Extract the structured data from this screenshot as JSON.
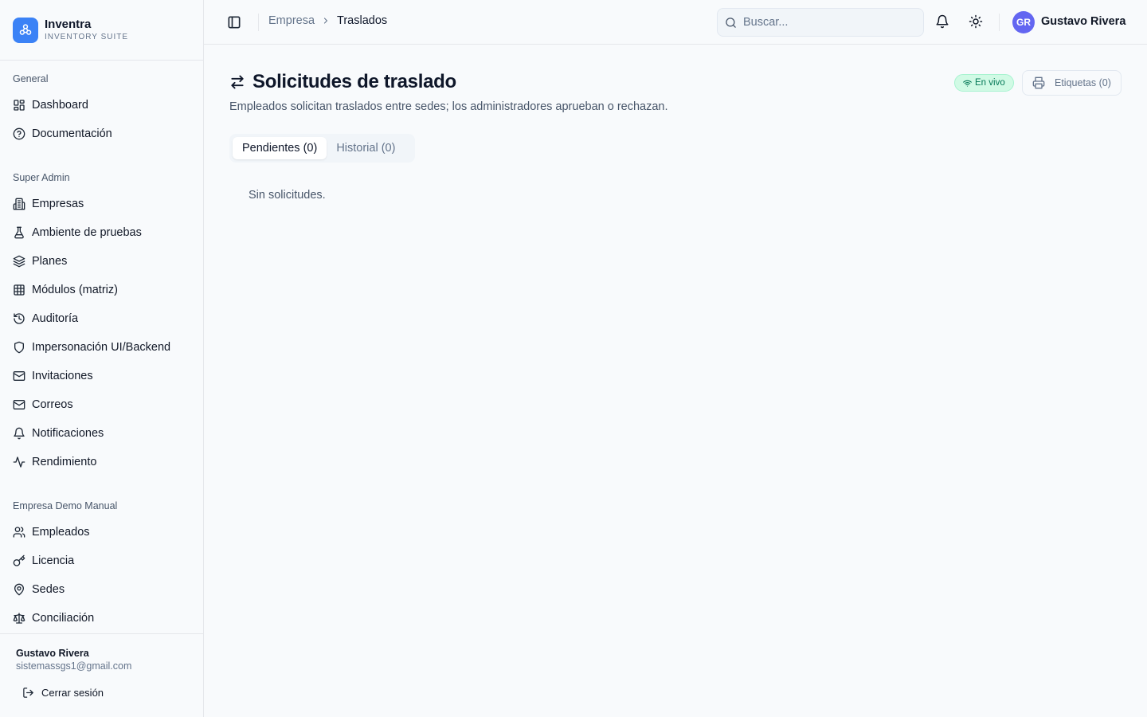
{
  "brand": {
    "name": "Inventra",
    "subtitle": "INVENTORY SUITE"
  },
  "sidebar": {
    "groups": [
      {
        "label": "General",
        "items": [
          {
            "label": "Dashboard",
            "icon": "layout-grid-icon"
          },
          {
            "label": "Documentación",
            "icon": "help-circle-icon"
          }
        ]
      },
      {
        "label": "Super Admin",
        "items": [
          {
            "label": "Empresas",
            "icon": "building-icon"
          },
          {
            "label": "Ambiente de pruebas",
            "icon": "flask-icon"
          },
          {
            "label": "Planes",
            "icon": "layers-icon"
          },
          {
            "label": "Módulos (matriz)",
            "icon": "table-icon"
          },
          {
            "label": "Auditoría",
            "icon": "history-icon"
          },
          {
            "label": "Impersonación UI/Backend",
            "icon": "shield-icon"
          },
          {
            "label": "Invitaciones",
            "icon": "mail-icon"
          },
          {
            "label": "Correos",
            "icon": "mail-icon"
          },
          {
            "label": "Notificaciones",
            "icon": "bell-icon"
          },
          {
            "label": "Rendimiento",
            "icon": "activity-icon"
          }
        ]
      },
      {
        "label": "Empresa Demo Manual",
        "items": [
          {
            "label": "Empleados",
            "icon": "users-icon"
          },
          {
            "label": "Licencia",
            "icon": "key-icon"
          },
          {
            "label": "Sedes",
            "icon": "map-pin-icon"
          },
          {
            "label": "Conciliación",
            "icon": "scale-icon"
          }
        ]
      }
    ],
    "footer": {
      "user_name": "Gustavo Rivera",
      "user_email": "sistemassgs1@gmail.com",
      "logout_label": "Cerrar sesión"
    }
  },
  "topbar": {
    "breadcrumb": {
      "parent": "Empresa",
      "current": "Traslados"
    },
    "search_placeholder": "Buscar...",
    "avatar_initials": "GR",
    "user_name": "Gustavo Rivera"
  },
  "page": {
    "title": "Solicitudes de traslado",
    "subtitle": "Empleados solicitan traslados entre sedes; los administradores aprueban o rechazan.",
    "live_badge": "En vivo",
    "labels_button": "Etiquetas (0)",
    "tabs": [
      {
        "label": "Pendientes (0)",
        "active": true
      },
      {
        "label": "Historial (0)",
        "active": false
      }
    ],
    "empty_message": "Sin solicitudes."
  },
  "colors": {
    "accent": "#3b82f6",
    "avatar": "#6366f1",
    "live_badge_bg": "#d1fae5",
    "live_badge_text": "#047857"
  }
}
